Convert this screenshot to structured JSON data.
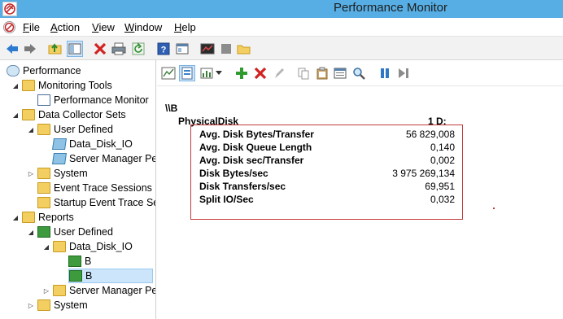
{
  "window": {
    "title": "Performance Monitor"
  },
  "menu": [
    {
      "first": "F",
      "rest": "ile"
    },
    {
      "first": "A",
      "rest": "ction"
    },
    {
      "first": "V",
      "rest": "iew"
    },
    {
      "first": "W",
      "rest": "indow"
    },
    {
      "first": "H",
      "rest": "elp"
    }
  ],
  "toolbar_icons": [
    "back-arrow",
    "forward-arrow",
    "up-folder",
    "show-hide-tree",
    "delete",
    "print",
    "refresh",
    "help",
    "properties",
    "perfmon-chart",
    "stop-square",
    "new-folder"
  ],
  "tree": [
    {
      "label": "Performance",
      "icon": "perf",
      "level": 0,
      "arrow": ""
    },
    {
      "label": "Monitoring Tools",
      "icon": "folder",
      "level": 1,
      "arrow": "◢"
    },
    {
      "label": "Performance Monitor",
      "icon": "monitor",
      "level": 2,
      "arrow": ""
    },
    {
      "label": "Data Collector Sets",
      "icon": "folder",
      "level": 1,
      "arrow": "◢"
    },
    {
      "label": "User Defined",
      "icon": "folder",
      "level": 2,
      "arrow": "◢"
    },
    {
      "label": "Data_Disk_IO",
      "icon": "cube",
      "level": 3,
      "arrow": ""
    },
    {
      "label": "Server Manager Per",
      "icon": "cube",
      "level": 3,
      "arrow": ""
    },
    {
      "label": "System",
      "icon": "folder",
      "level": 2,
      "arrow": "▷"
    },
    {
      "label": "Event Trace Sessions",
      "icon": "folder-doc",
      "level": 2,
      "arrow": ""
    },
    {
      "label": "Startup Event Trace Ses",
      "icon": "folder-doc",
      "level": 2,
      "arrow": ""
    },
    {
      "label": "Reports",
      "icon": "folder",
      "level": 1,
      "arrow": "◢"
    },
    {
      "label": "User Defined",
      "icon": "report",
      "level": 2,
      "arrow": "◢"
    },
    {
      "label": "Data_Disk_IO",
      "icon": "folder",
      "level": 3,
      "arrow": "◢"
    },
    {
      "label": "B",
      "icon": "report",
      "level": 4,
      "arrow": ""
    },
    {
      "label": "B",
      "icon": "report",
      "level": 4,
      "arrow": ""
    },
    {
      "label": "Server Manager Per",
      "icon": "folder",
      "level": 3,
      "arrow": "▷"
    },
    {
      "label": "System",
      "icon": "folder",
      "level": 2,
      "arrow": "▷"
    }
  ],
  "report_toolbar_icons": [
    "change-graph-type",
    "view-report",
    "dropdown",
    "add-counter",
    "delete-counter",
    "highlight",
    "copy-properties",
    "paste-counter-list",
    "properties",
    "zoom",
    "freeze-display",
    "update-data"
  ],
  "report": {
    "machine": "\\\\B",
    "object": "PhysicalDisk",
    "instance": "1 D:",
    "counters": [
      {
        "name": "Avg. Disk Bytes/Transfer",
        "value": "56 829,008"
      },
      {
        "name": "Avg. Disk Queue Length",
        "value": "0,140"
      },
      {
        "name": "Avg. Disk sec/Transfer",
        "value": "0,002"
      },
      {
        "name": "Disk Bytes/sec",
        "value": "3 975 269,134"
      },
      {
        "name": "Disk Transfers/sec",
        "value": "69,951"
      },
      {
        "name": "Split IO/Sec",
        "value": "0,032"
      }
    ]
  },
  "colors": {
    "titlebar": "#57aee4",
    "highlight_border": "#c23b3b"
  }
}
